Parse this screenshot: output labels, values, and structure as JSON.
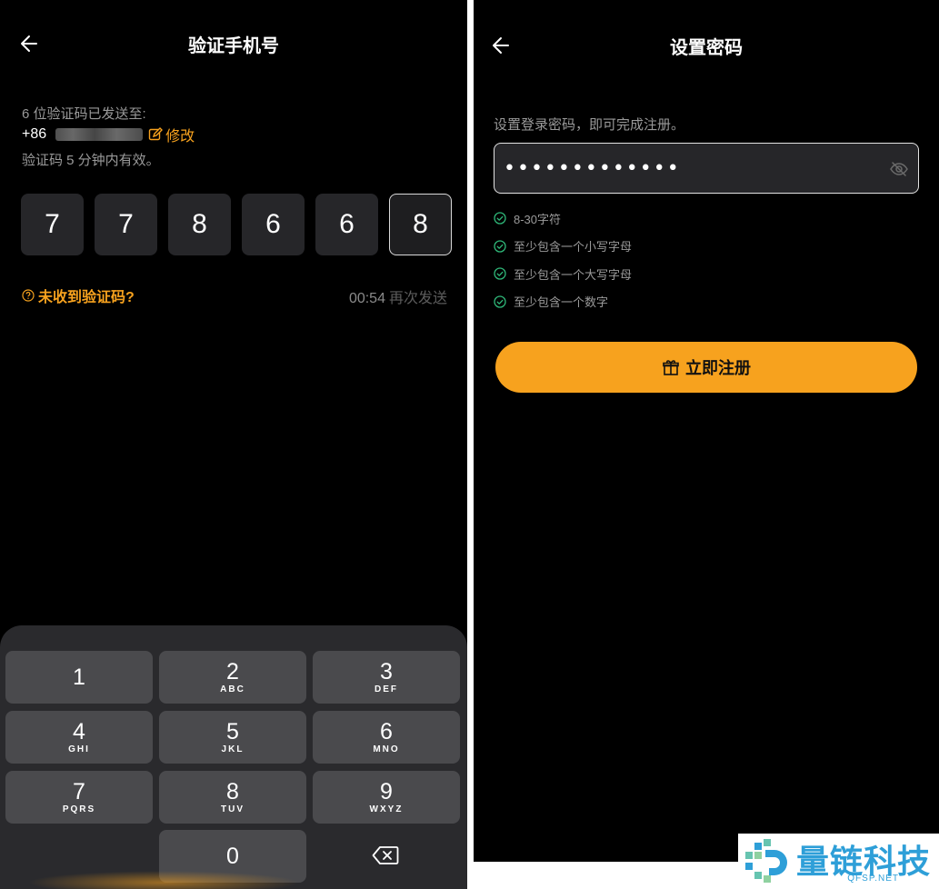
{
  "left": {
    "title": "验证手机号",
    "sent_to": "6 位验证码已发送至:",
    "phone_prefix": "+86",
    "edit_label": "修改",
    "validity": "验证码 5 分钟内有效。",
    "code_digits": [
      "7",
      "7",
      "8",
      "6",
      "6",
      "8"
    ],
    "not_received": "未收到验证码?",
    "timer": "00:54",
    "resend": "再次发送",
    "keypad": [
      {
        "num": "1",
        "letters": ""
      },
      {
        "num": "2",
        "letters": "ABC"
      },
      {
        "num": "3",
        "letters": "DEF"
      },
      {
        "num": "4",
        "letters": "GHI"
      },
      {
        "num": "5",
        "letters": "JKL"
      },
      {
        "num": "6",
        "letters": "MNO"
      },
      {
        "num": "7",
        "letters": "PQRS"
      },
      {
        "num": "8",
        "letters": "TUV"
      },
      {
        "num": "9",
        "letters": "WXYZ"
      },
      {
        "num": "0",
        "letters": ""
      }
    ]
  },
  "right": {
    "title": "设置密码",
    "subtitle": "设置登录密码，即可完成注册。",
    "password_value": "•••••••••••••",
    "rules": [
      "8-30字符",
      "至少包含一个小写字母",
      "至少包含一个大写字母",
      "至少包含一个数字"
    ],
    "register_label": "立即注册"
  },
  "watermark": {
    "text": "量链科技",
    "sub": "QFSP.NET"
  },
  "colors": {
    "accent": "#f7a21e",
    "rule_check": "#2fb879",
    "watermark": "#2e9fd8"
  },
  "icons": {
    "back": "arrow-left-icon",
    "edit": "edit-icon",
    "help": "question-circle-icon",
    "backspace": "backspace-icon",
    "eye": "eye-off-icon",
    "check": "check-circle-icon",
    "gift": "gift-icon"
  }
}
